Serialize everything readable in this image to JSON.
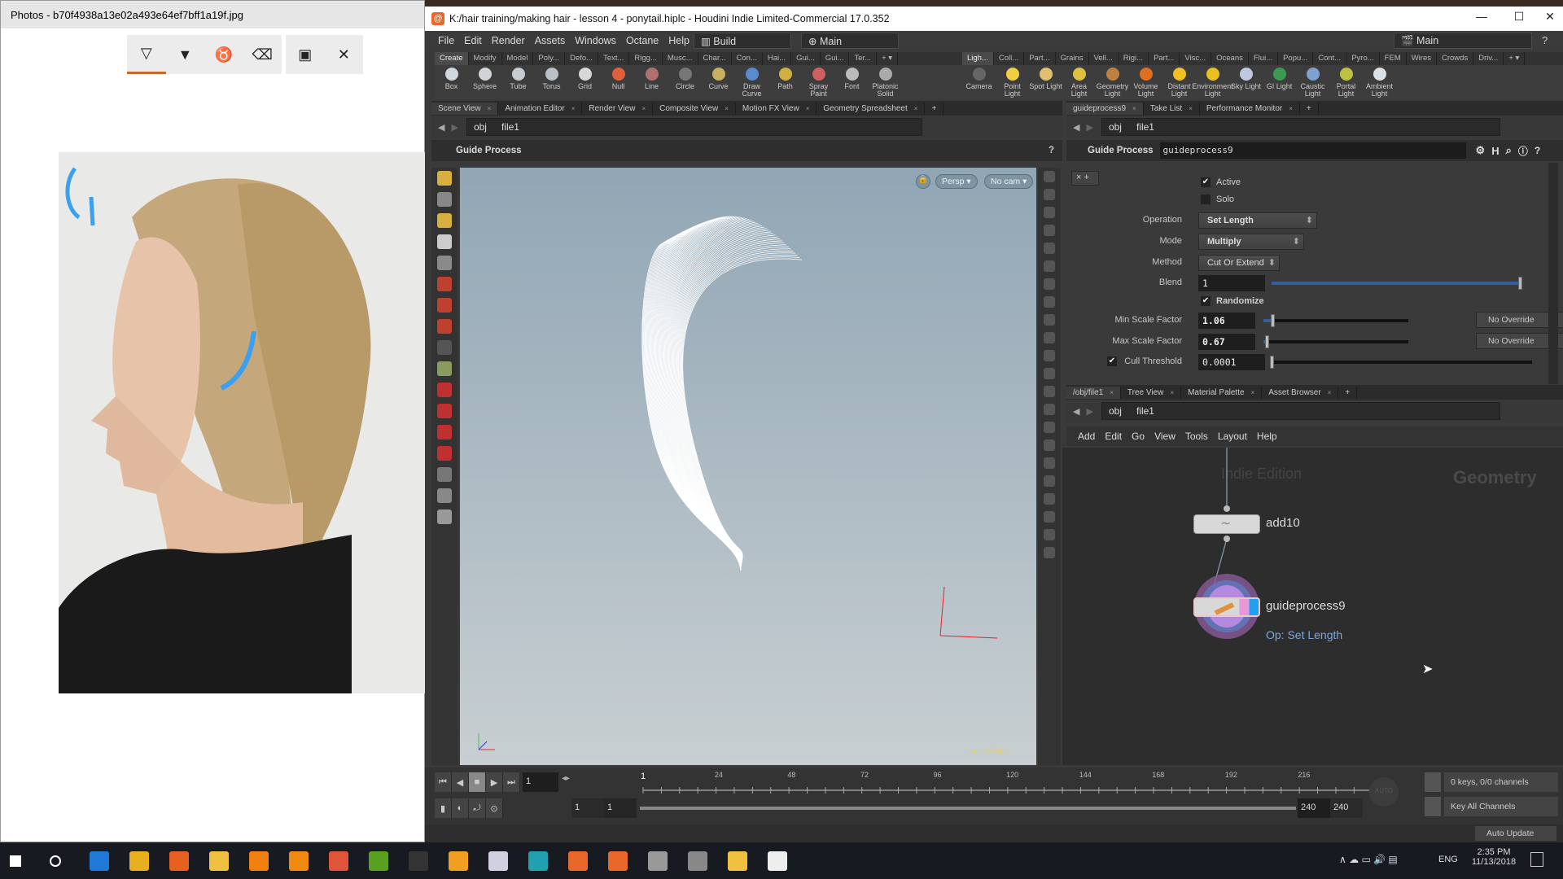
{
  "photos": {
    "title": "Photos - b70f4938a13e02a493e64ef7bff1a19f.jpg",
    "tools": [
      {
        "icon": "ballpoint-pen-icon",
        "glyph": "▽",
        "selected": true
      },
      {
        "icon": "pencil-icon",
        "glyph": "▼"
      },
      {
        "icon": "calligraphy-pen-icon",
        "glyph": "♉"
      },
      {
        "icon": "eraser-icon",
        "glyph": "⌫"
      }
    ],
    "save_icon": "▣",
    "close_icon": "✕",
    "annotation_color": "#3aa0f0"
  },
  "houdini": {
    "title": "K:/hair training/making hair - lesson 4 - ponytail.hiplc - Houdini Indie Limited-Commercial 17.0.352",
    "menus": [
      "File",
      "Edit",
      "Render",
      "Assets",
      "Windows",
      "Octane",
      "Help"
    ],
    "desktop": "Build",
    "context": "Main",
    "takes": "Main",
    "shelf_left": {
      "tabs": [
        "Create",
        "Modify",
        "Model",
        "Poly...",
        "Defo...",
        "Text...",
        "Rigg...",
        "Musc...",
        "Char...",
        "Con...",
        "Hai...",
        "Gui...",
        "Gui...",
        "Ter..."
      ],
      "tools": [
        {
          "label": "Box",
          "color": "#cfd6dc"
        },
        {
          "label": "Sphere",
          "color": "#d0d4d8"
        },
        {
          "label": "Tube",
          "color": "#c6ccd2"
        },
        {
          "label": "Torus",
          "color": "#b8c0c8"
        },
        {
          "label": "Grid",
          "color": "#d8d8d8"
        },
        {
          "label": "Null",
          "color": "#e0603a"
        },
        {
          "label": "Line",
          "color": "#b07070"
        },
        {
          "label": "Circle",
          "color": "#777"
        },
        {
          "label": "Curve",
          "color": "#c8b060"
        },
        {
          "label": "Draw Curve",
          "color": "#5a8ad0"
        },
        {
          "label": "Path",
          "color": "#d0b040"
        },
        {
          "label": "Spray Paint",
          "color": "#d06060"
        },
        {
          "label": "Font",
          "color": "#bbbbbb"
        },
        {
          "label": "Platonic Solid",
          "color": "#aaa"
        }
      ]
    },
    "shelf_right": {
      "tabs": [
        "Ligh...",
        "Coll...",
        "Part...",
        "Grains",
        "Vell...",
        "Rigi...",
        "Part...",
        "Visc...",
        "Oceans",
        "Flui...",
        "Popu...",
        "Cont...",
        "Pyro...",
        "FEM",
        "Wires",
        "Crowds",
        "Driv..."
      ],
      "tools": [
        {
          "label": "Camera",
          "color": "#666"
        },
        {
          "label": "Point Light",
          "color": "#f0d040"
        },
        {
          "label": "Spot Light",
          "color": "#e0c070"
        },
        {
          "label": "Area Light",
          "color": "#e0c040"
        },
        {
          "label": "Geometry Light",
          "color": "#c08040"
        },
        {
          "label": "Volume Light",
          "color": "#e07020"
        },
        {
          "label": "Distant Light",
          "color": "#f0c020"
        },
        {
          "label": "Environment Light",
          "color": "#e8c020"
        },
        {
          "label": "Sky Light",
          "color": "#c0c8e0"
        },
        {
          "label": "GI Light",
          "color": "#3a9a50"
        },
        {
          "label": "Caustic Light",
          "color": "#80a0d0"
        },
        {
          "label": "Portal Light",
          "color": "#c0c040"
        },
        {
          "label": "Ambient Light",
          "color": "#d8e0e8"
        }
      ]
    },
    "left_pane": {
      "tabs": [
        "Scene View",
        "Animation Editor",
        "Render View",
        "Composite View",
        "Motion FX View",
        "Geometry Spreadsheet"
      ],
      "path": [
        "obj",
        "file1"
      ],
      "header": "Guide Process",
      "viewport": {
        "persp": "Persp ▾",
        "cam": "No cam ▾",
        "watermark": "Indie Edition"
      }
    },
    "params": {
      "tabs": [
        "guideprocess9",
        "Take List",
        "Performance Monitor"
      ],
      "path": [
        "obj",
        "file1"
      ],
      "node_type": "Guide Process",
      "node_name": "guideprocess9",
      "active": {
        "label": "Active",
        "checked": true
      },
      "solo": {
        "label": "Solo",
        "checked": false
      },
      "operation": {
        "label": "Operation",
        "value": "Set Length"
      },
      "mode": {
        "label": "Mode",
        "value": "Multiply"
      },
      "method": {
        "label": "Method",
        "value": "Cut Or Extend"
      },
      "blend": {
        "label": "Blend",
        "value": "1",
        "slider": 1.0
      },
      "randomize": {
        "label": "Randomize",
        "checked": true
      },
      "min_scale": {
        "label": "Min Scale Factor",
        "value": "1.06",
        "override": "No Override",
        "slider": 0.06
      },
      "max_scale": {
        "label": "Max Scale Factor",
        "value": "0.67",
        "override": "No Override",
        "slider": 0.02
      },
      "cull": {
        "label": "Cull Threshold",
        "value": "0.0001",
        "checked": true,
        "slider": 0.0
      }
    },
    "network": {
      "tabs": [
        "/obj/file1",
        "Tree View",
        "Material Palette",
        "Asset Browser"
      ],
      "path": [
        "obj",
        "file1"
      ],
      "menus": [
        "Add",
        "Edit",
        "Go",
        "View",
        "Tools",
        "Layout",
        "Help"
      ],
      "watermark": "Indie Edition",
      "context_label": "Geometry",
      "nodes": [
        {
          "name": "add10"
        },
        {
          "name": "guideprocess9",
          "comment": "Op: Set Length"
        }
      ]
    },
    "timeline": {
      "current_frame": "1",
      "frame_field": "1",
      "range_start": 1,
      "range_end": 240,
      "tick_labels": [
        "24",
        "48",
        "72",
        "96",
        "120",
        "144",
        "168",
        "192",
        "216"
      ],
      "start_fields": [
        "1",
        "1"
      ],
      "end_fields": [
        "240",
        "240"
      ],
      "keys_info": "0 keys, 0/0 channels",
      "key_all": "Key All Channels",
      "auto_update": "Auto Update"
    }
  },
  "taskbar": {
    "icons": [
      {
        "name": "start",
        "color": "#ffffff"
      },
      {
        "name": "cortana",
        "color": "#ffffff"
      },
      {
        "name": "edge",
        "color": "#1e7ad6"
      },
      {
        "name": "chrome",
        "color": "#e8b020"
      },
      {
        "name": "firefox",
        "color": "#e66020"
      },
      {
        "name": "file-explorer",
        "color": "#f0c040"
      },
      {
        "name": "vlc",
        "color": "#f08010"
      },
      {
        "name": "search-app",
        "color": "#f08a10"
      },
      {
        "name": "app-c-red",
        "color": "#e0553a"
      },
      {
        "name": "app-c-green",
        "color": "#5aa020"
      },
      {
        "name": "daz-studio",
        "color": "#333"
      },
      {
        "name": "marvelous",
        "color": "#f0a020"
      },
      {
        "name": "zbrush",
        "color": "#d0d0e0"
      },
      {
        "name": "3ds-max",
        "color": "#20a0b0"
      },
      {
        "name": "houdini-1",
        "color": "#e8672a"
      },
      {
        "name": "houdini-2",
        "color": "#e8672a"
      },
      {
        "name": "settings-app",
        "color": "#999"
      },
      {
        "name": "app-m",
        "color": "#888"
      },
      {
        "name": "folder-app",
        "color": "#f0c040"
      },
      {
        "name": "photos",
        "color": "#eeeeee"
      }
    ],
    "language": "ENG",
    "time": "2:35 PM",
    "date": "11/13/2018"
  }
}
